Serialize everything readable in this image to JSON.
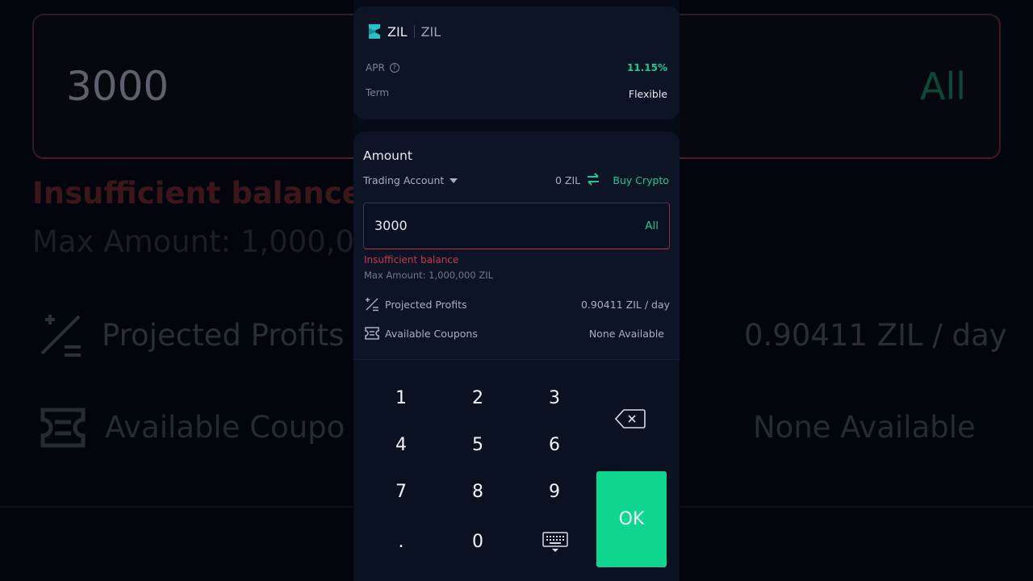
{
  "product": {
    "coin": "ZIL",
    "coin_sub": "ZIL",
    "apr_label": "APR",
    "apr_value": "11.15%",
    "term_label": "Term",
    "term_value": "Flexible"
  },
  "amount": {
    "title": "Amount",
    "account_label": "Trading Account",
    "balance": "0 ZIL",
    "buy_crypto_label": "Buy Crypto",
    "input_value": "3000",
    "all_label": "All",
    "error_text": "Insufficient balance",
    "max_text": "Max Amount: 1,000,000 ZIL",
    "projected_profits_label": "Projected Profits",
    "projected_profits_value": "0.90411 ZIL / day",
    "coupons_label": "Available Coupons",
    "coupons_value": "None Available"
  },
  "keypad": {
    "keys": [
      "1",
      "2",
      "3",
      "4",
      "5",
      "6",
      "7",
      "8",
      "9",
      ".",
      "0"
    ],
    "ok_label": "OK",
    "backspace_icon": "backspace-icon",
    "keyboard_icon": "keyboard-hide-icon"
  },
  "background": {
    "input_value": "3000",
    "all_label": "All",
    "error_text": "Insufficient balance",
    "max_text": "Max Amount: 1,000,0",
    "profit_label": "Projected Profits",
    "profit_value": "0.90411 ZIL / day",
    "coupon_label": "Available Coupo",
    "coupon_value": "None Available"
  },
  "colors": {
    "accent_green": "#1ec98f",
    "ok_button": "#0fd68e",
    "error_red": "#c8384c",
    "card_bg": "#0c1426",
    "page_bg": "#060b17"
  }
}
